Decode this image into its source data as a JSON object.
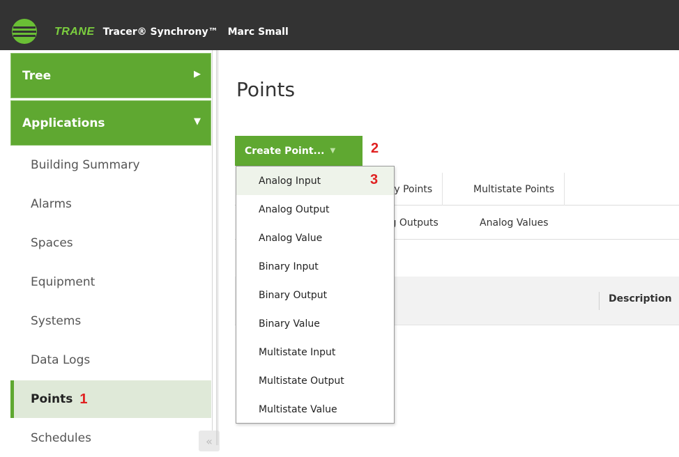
{
  "header": {
    "brand": "TRANE",
    "product": "Tracer® Synchrony™",
    "user": "Marc Small",
    "bg": "#333333",
    "accent": "#7ccf3f"
  },
  "sidebar": {
    "tree_label": "Tree",
    "tree_arrow": "▶",
    "applications_label": "Applications",
    "applications_arrow": "▼",
    "items": [
      {
        "label": "Building Summary"
      },
      {
        "label": "Alarms"
      },
      {
        "label": "Spaces"
      },
      {
        "label": "Equipment"
      },
      {
        "label": "Systems"
      },
      {
        "label": "Data Logs"
      },
      {
        "label": "Points",
        "active": true,
        "annotation": "1"
      },
      {
        "label": "Schedules"
      }
    ],
    "collapse_icon": "«"
  },
  "main": {
    "title": "Points",
    "create_button": "Create Point...",
    "create_annotation": "2",
    "tabs_row1": [
      "ary Points",
      "Multistate Points"
    ],
    "tabs_row2": [
      "og Outputs",
      "Analog Values"
    ],
    "grid_header_description": "Description"
  },
  "dropdown": {
    "items": [
      {
        "label": "Analog Input",
        "annotation": "3"
      },
      {
        "label": "Analog Output"
      },
      {
        "label": "Analog Value"
      },
      {
        "label": "Binary Input"
      },
      {
        "label": "Binary Output"
      },
      {
        "label": "Binary Value"
      },
      {
        "label": "Multistate Input"
      },
      {
        "label": "Multistate Output"
      },
      {
        "label": "Multistate Value"
      }
    ]
  },
  "colors": {
    "green": "#5fa831",
    "active_bg": "#dfe9d8",
    "annotation_red": "#e02020"
  }
}
